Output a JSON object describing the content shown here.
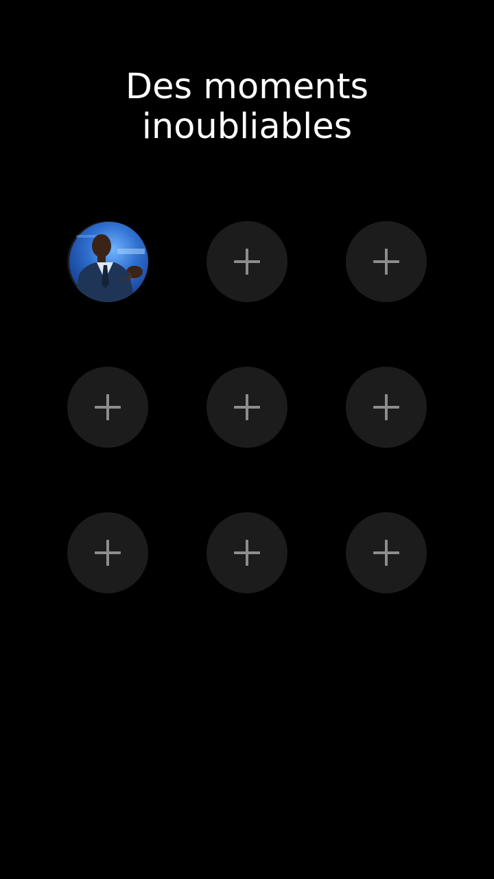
{
  "title": {
    "line1": "Des moments",
    "line2": "inoubliables"
  },
  "slots": [
    {
      "filled": true,
      "icon": "avatar-photo"
    },
    {
      "filled": false,
      "icon": "plus-icon"
    },
    {
      "filled": false,
      "icon": "plus-icon"
    },
    {
      "filled": false,
      "icon": "plus-icon"
    },
    {
      "filled": false,
      "icon": "plus-icon"
    },
    {
      "filled": false,
      "icon": "plus-icon"
    },
    {
      "filled": false,
      "icon": "plus-icon"
    },
    {
      "filled": false,
      "icon": "plus-icon"
    },
    {
      "filled": false,
      "icon": "plus-icon"
    }
  ],
  "colors": {
    "background": "#000000",
    "slot": "#1c1c1c",
    "plus": "#8d8d8d",
    "title": "#ffffff"
  }
}
